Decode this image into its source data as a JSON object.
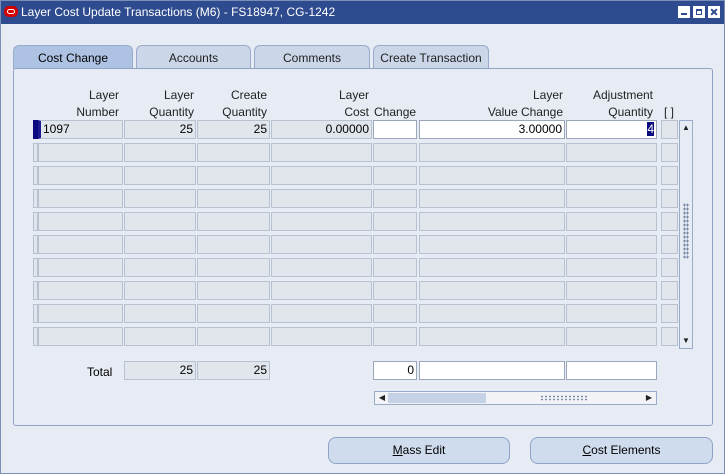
{
  "window": {
    "title": "Layer Cost Update Transactions (M6) - FS18947, CG-1242"
  },
  "tabs": [
    "Cost Change",
    "Accounts",
    "Comments",
    "Create Transaction"
  ],
  "columns": {
    "layer_number": [
      "Layer",
      "Number"
    ],
    "layer_quantity": [
      "Layer",
      "Quantity"
    ],
    "create_quantity": [
      "Create",
      "Quantity"
    ],
    "layer_cost": [
      "Layer",
      "Cost"
    ],
    "change": "Change",
    "layer_value_change": [
      "Layer",
      "Value Change"
    ],
    "adjustment_quantity": [
      "Adjustment",
      "Quantity"
    ],
    "flex": "[ ]"
  },
  "row1": {
    "layer_number": "1097",
    "layer_quantity": "25",
    "create_quantity": "25",
    "layer_cost": "0.00000",
    "change": "",
    "layer_value_change": "3.00000",
    "adjustment_quantity": "4"
  },
  "totals": {
    "label": "Total",
    "layer_quantity": "25",
    "create_quantity": "25",
    "change": "0",
    "layer_value_change": "",
    "adjustment_quantity": ""
  },
  "buttons": {
    "mass_edit": {
      "mnemonic": "M",
      "rest": "ass Edit"
    },
    "cost_elements": {
      "mnemonic": "C",
      "rest": "ost Elements"
    }
  }
}
